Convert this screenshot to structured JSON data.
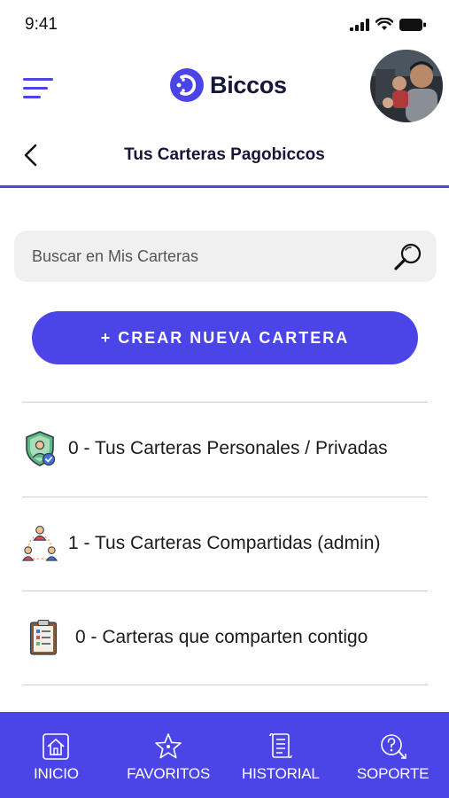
{
  "status_bar": {
    "time": "9:41",
    "icons": [
      "signal-icon",
      "wifi-icon",
      "battery-icon"
    ]
  },
  "header": {
    "brand": "Biccos",
    "menu_icon": "hamburger-menu-icon",
    "avatar_icon": "user-avatar"
  },
  "title_bar": {
    "title": "Tus Carteras Pagobiccos",
    "back_icon": "chevron-left-icon"
  },
  "search": {
    "placeholder": "Buscar en Mis Carteras",
    "icon": "search-icon"
  },
  "create_button": {
    "label": "+ CREAR NUEVA CARTERA"
  },
  "wallet_list": [
    {
      "label": "0 - Tus Carteras Personales / Privadas",
      "icon": "shield-user-icon"
    },
    {
      "label": "1 - Tus Carteras Compartidas (admin)",
      "icon": "shared-users-icon"
    },
    {
      "label": "0 - Carteras que comparten contigo",
      "icon": "clipboard-icon"
    }
  ],
  "bottom_nav": [
    {
      "label": "INICIO",
      "icon": "home-icon"
    },
    {
      "label": "FAVORITOS",
      "icon": "star-icon"
    },
    {
      "label": "HISTORIAL",
      "icon": "scroll-icon"
    },
    {
      "label": "SOPORTE",
      "icon": "support-icon"
    }
  ],
  "colors": {
    "accent": "#4b45e8",
    "background": "#ffffff",
    "search_bg": "#f0f0f1",
    "divider": "#cfcfcf"
  }
}
